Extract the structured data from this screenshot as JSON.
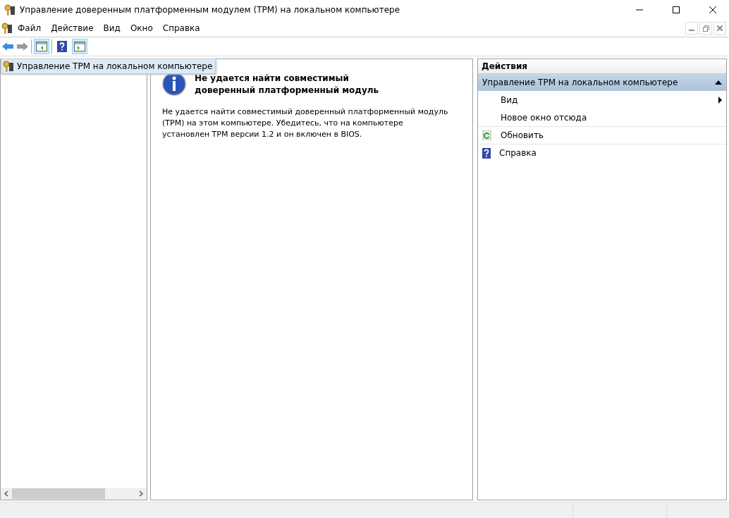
{
  "window": {
    "title": "Управление доверенным платформенным модулем (TPM) на локальном компьютере"
  },
  "menu": [
    "Файл",
    "Действие",
    "Вид",
    "Окно",
    "Справка"
  ],
  "toolbar": [
    {
      "kind": "back",
      "disabled": false
    },
    {
      "kind": "forward",
      "disabled": true
    },
    {
      "kind": "sep"
    },
    {
      "kind": "tree",
      "selected": true
    },
    {
      "kind": "sep"
    },
    {
      "kind": "help",
      "selected": false
    },
    {
      "kind": "actions",
      "selected": true
    }
  ],
  "tree": {
    "items": [
      {
        "label": "Управление TPM на локальном компьютере",
        "selected": true
      }
    ]
  },
  "message": {
    "title": "Не удается найти совместимый доверенный платформенный модуль",
    "body": "Не удается найти совместимый доверенный платформенный модуль (TPM) на этом компьютере. Убедитесь, что на компьютере установлен TPM версии 1.2 и он включен в BIOS."
  },
  "actions": {
    "title": "Действия",
    "section": {
      "label": "Управление TPM на локальном компьютере",
      "expanded": true
    },
    "items": [
      {
        "label": "Вид",
        "kind": "submenu"
      },
      {
        "label": "Новое окно отсюда",
        "kind": "plain"
      },
      {
        "label": "Обновить",
        "kind": "refresh"
      },
      {
        "label": "Справка",
        "kind": "help"
      }
    ]
  }
}
